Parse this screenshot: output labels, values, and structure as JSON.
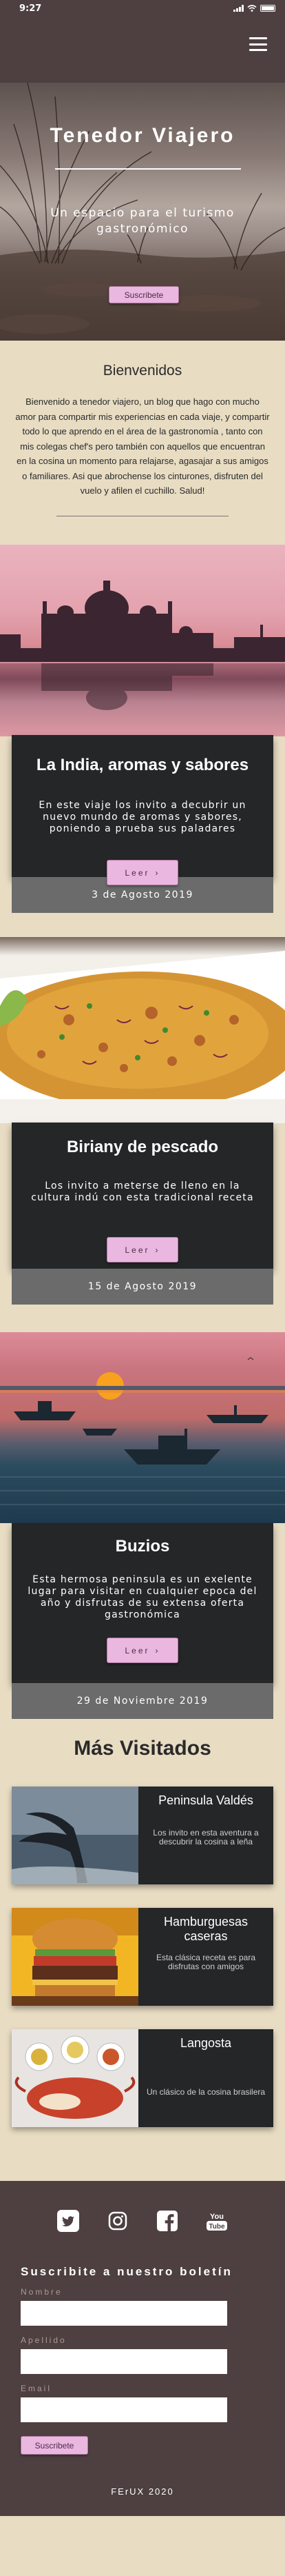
{
  "status_bar": {
    "time": "9:27"
  },
  "hero": {
    "title": "Tenedor Viajero",
    "subtitle": "Un espacio para el turismo gastronómico",
    "subscribe_label": "Suscribete"
  },
  "welcome": {
    "heading": "Bienvenidos",
    "body": "Bienvenido a tenedor viajero, un blog que hago con mucho amor para compartir mis experiencias en cada viaje, y compartir todo lo que aprendo en el área de la gastronomía , tanto con mis colegas chef's pero también con aquellos que encuentran en la cosina un momento para relajarse, agasajar a sus amigos o familiares. Asi que abrochense los cinturones, disfruten del vuelo y afilen el cuchillo. Salud!"
  },
  "articles": [
    {
      "title": "La India, aromas y sabores",
      "description": "En este viaje los invito a decubrir un nuevo mundo de aromas y sabores, poniendo a prueba sus paladares",
      "read_label": "Leer",
      "date": "3 de Agosto 2019"
    },
    {
      "title": "Biriany de pescado",
      "description": "Los invito a meterse de lleno en la cultura indú con esta tradicional receta",
      "read_label": "Leer",
      "date": "15 de Agosto 2019"
    },
    {
      "title": "Buzios",
      "description": "Esta hermosa peninsula es un exelente lugar para visitar en cualquier epoca del año y disfrutas de su extensa oferta gastronómica",
      "read_label": "Leer",
      "date": "29 de Noviembre 2019"
    }
  ],
  "most_visited": {
    "heading": "Más Visitados",
    "items": [
      {
        "title": "Peninsula Valdés",
        "description": "Los invito en esta aventura a descubrir la cosina a leña"
      },
      {
        "title": "Hamburguesas caseras",
        "description": "Esta clásica receta es para disfrutas con amigos"
      },
      {
        "title": "Langosta",
        "description": "Un clásico de la cosina brasilera"
      }
    ]
  },
  "footer": {
    "social_icons": [
      "twitter-icon",
      "instagram-icon",
      "facebook-icon",
      "youtube-icon"
    ],
    "youtube_label": "You Tube",
    "newsletter_title": "Suscribite a nuestro boletín",
    "fields": [
      {
        "label": "Nombre",
        "value": ""
      },
      {
        "label": "Apellido",
        "value": ""
      },
      {
        "label": "Email",
        "value": ""
      }
    ],
    "subscribe_label": "Suscribete",
    "copyright": "FErUX 2020"
  },
  "colors": {
    "nav_bg": "#4e4040",
    "page_bg": "#e8dcc3",
    "card_bg": "#242627",
    "date_bar": "#6b6b6b",
    "button_pink": "#e9b7e0"
  }
}
